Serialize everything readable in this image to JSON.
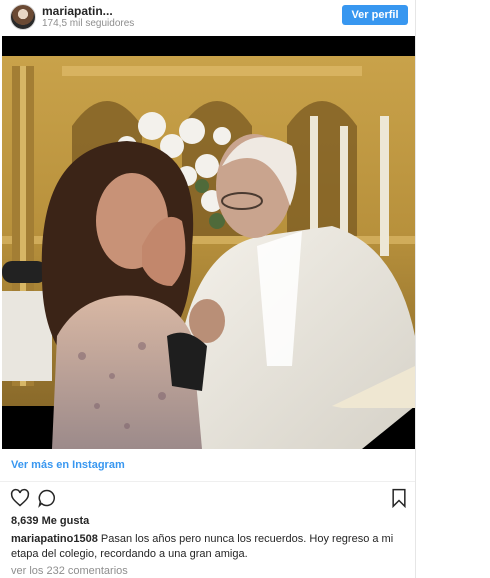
{
  "header": {
    "username": "mariapatin...",
    "followers": "174,5 mil seguidores",
    "profile_button": "Ver perfil"
  },
  "post": {
    "image_alt": "Photo of a woman touching her face in front of an elderly priest at an altar",
    "more_link": "Ver más en Instagram",
    "likes": "8,639 Me gusta",
    "caption_user": "mariapatino1508",
    "caption_text": "Pasan los años pero nunca los recuerdos. Hoy regreso a mi etapa del colegio, recordando a una gran amiga.",
    "comments_link": "ver los 232 comentarios"
  },
  "icons": {
    "like": "heart-icon",
    "comment": "comment-icon",
    "save": "bookmark-icon"
  },
  "colors": {
    "accent": "#3897f0",
    "text": "#262626",
    "muted": "#8e8e8e"
  }
}
